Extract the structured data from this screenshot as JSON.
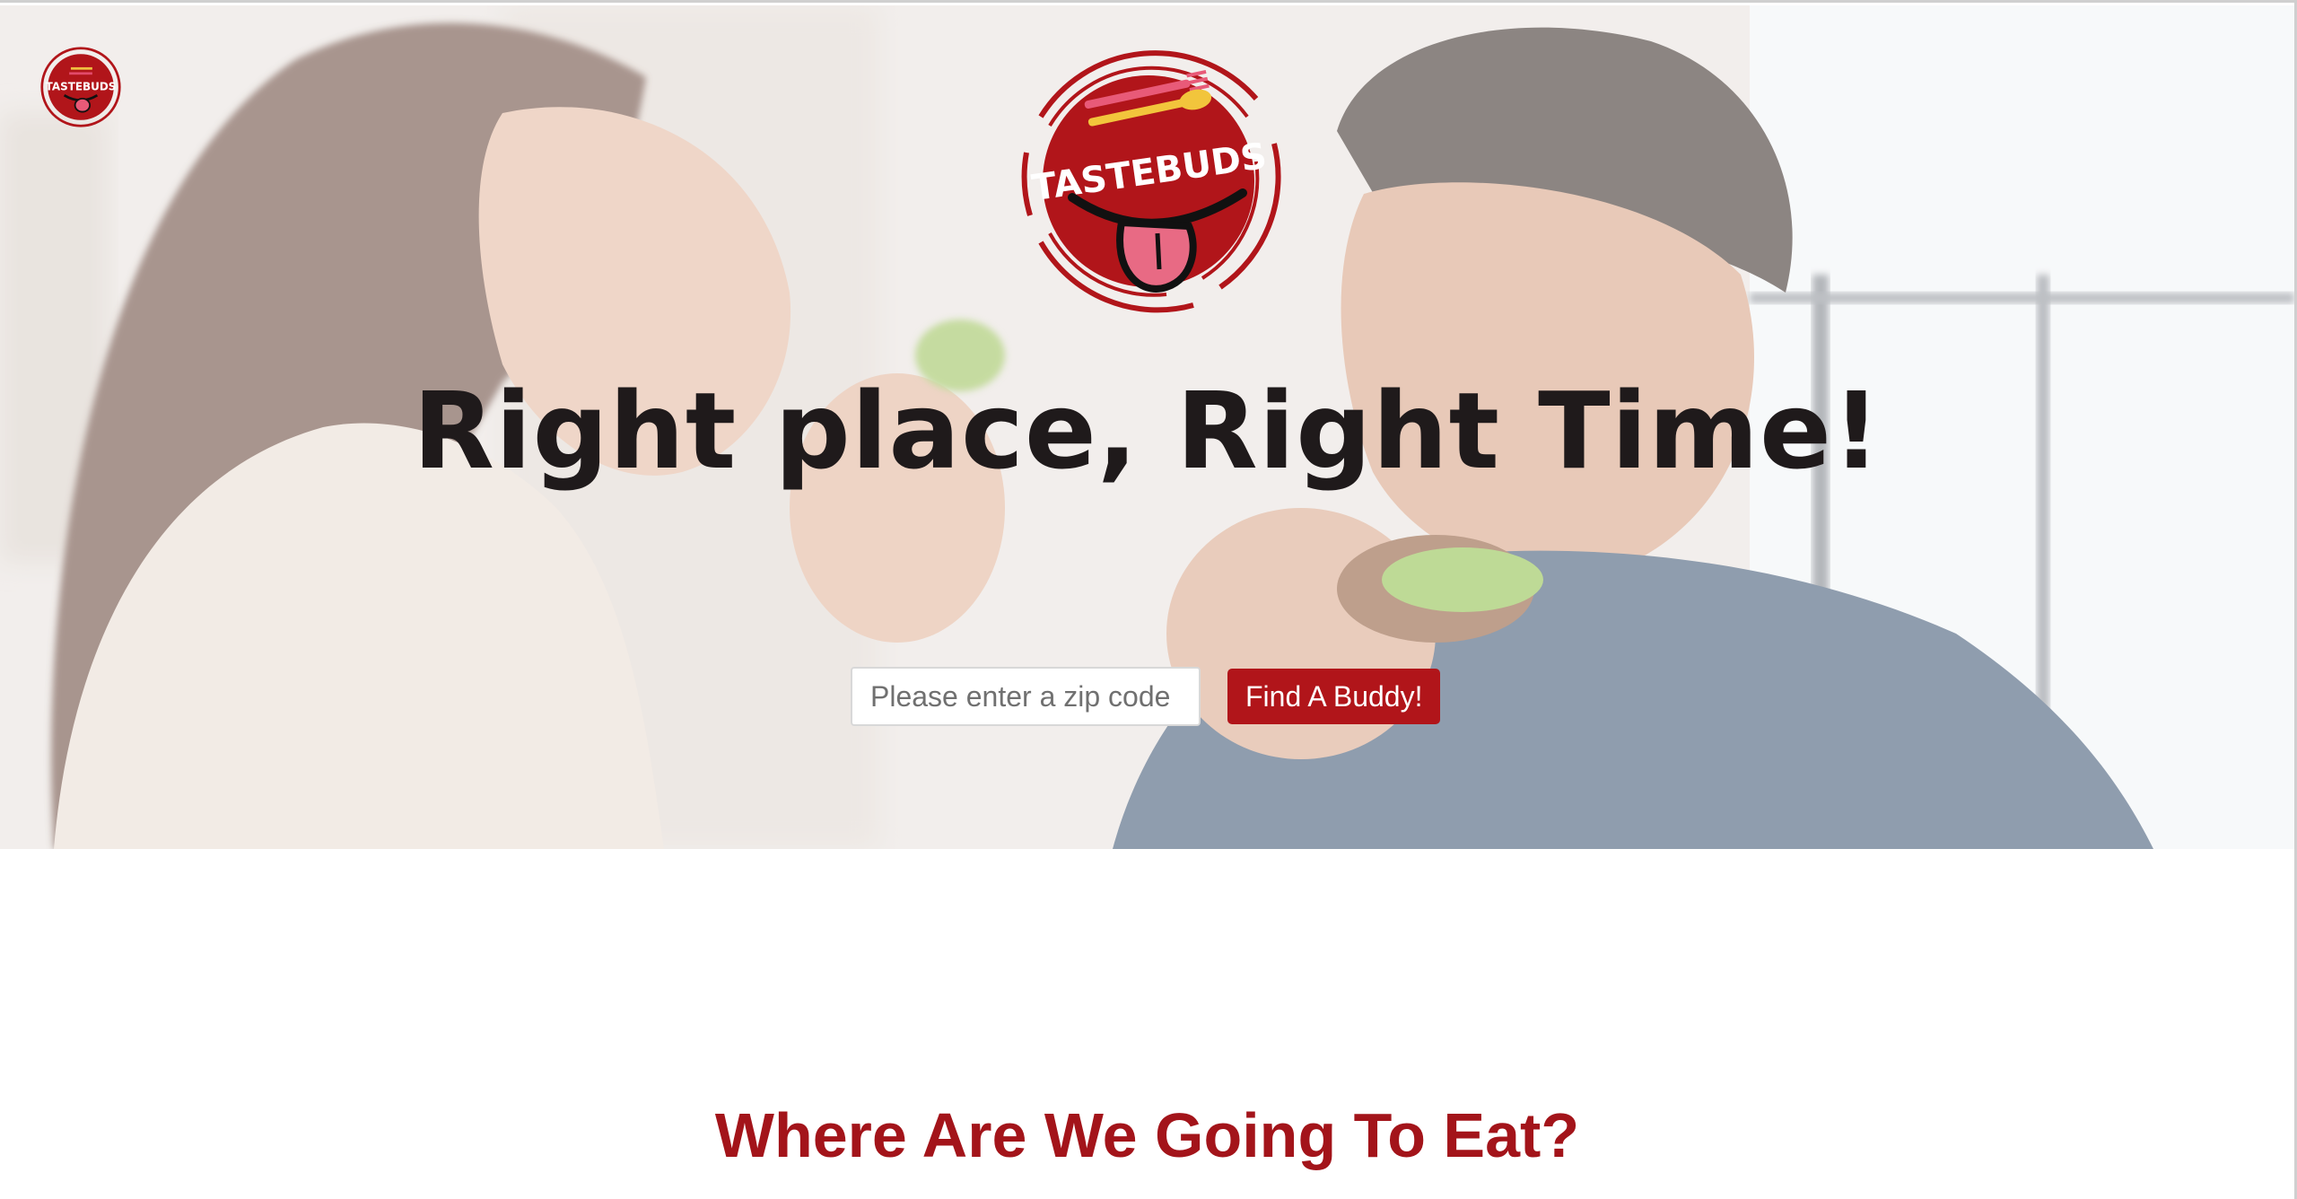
{
  "brand": {
    "name": "TASTEBUDS",
    "colors": {
      "primary": "#b1151a",
      "heading": "#a3141a",
      "headline": "#1f1a1b"
    }
  },
  "hero": {
    "headline": "Right place, Right Time!",
    "background_image": "couple-eating-sandwiches-photo",
    "search": {
      "placeholder": "Please enter a zip code",
      "value": "",
      "button_label": "Find A Buddy!"
    }
  },
  "section": {
    "title": "Where Are We Going To Eat?"
  }
}
